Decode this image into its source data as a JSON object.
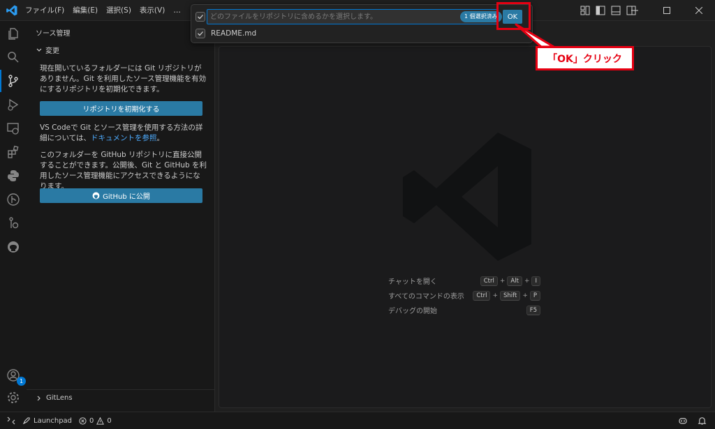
{
  "menu": [
    "ファイル(F)",
    "編集(E)",
    "選択(S)",
    "表示(V)",
    "…"
  ],
  "sidebar": {
    "title": "ソース管理",
    "section": "変更",
    "no_repo_text": "現在開いているフォルダーには Git リポジトリがありません。Git を利用したソース管理機能を有効にするリポジトリを初期化できます。",
    "init_button": "リポジトリを初期化する",
    "docs_text": "VS Codeで Git とソース管理を使用する方法の詳細については、",
    "docs_link": "ドキュメントを参照",
    "docs_end": "。",
    "publish_text": "このフォルダーを GitHub リポジトリに直接公開することができます。公開後、Git と GitHub を利用したソース管理機能にアクセスできるようになります。",
    "publish_button": "GitHub に公開",
    "gitlens": "GitLens"
  },
  "quick_input": {
    "placeholder": "どのファイルをリポジトリに含めるかを選択します。",
    "count_badge": "1 個選択済み",
    "ok_button": "OK",
    "items": [
      {
        "label": "README.md",
        "checked": true
      }
    ]
  },
  "callout": "「OK」クリック",
  "shortcuts": [
    {
      "label": "チャットを開く",
      "keys": [
        "Ctrl",
        "Alt",
        "I"
      ]
    },
    {
      "label": "すべてのコマンドの表示",
      "keys": [
        "Ctrl",
        "Shift",
        "P"
      ]
    },
    {
      "label": "デバッグの開始",
      "keys": [
        "F5"
      ]
    }
  ],
  "accounts_badge": "1",
  "status": {
    "launchpad": "Launchpad",
    "errors": "0",
    "warnings": "0"
  },
  "colors": {
    "accent": "#0078d4",
    "button": "#2a7aa4",
    "highlight": "#e60012"
  }
}
